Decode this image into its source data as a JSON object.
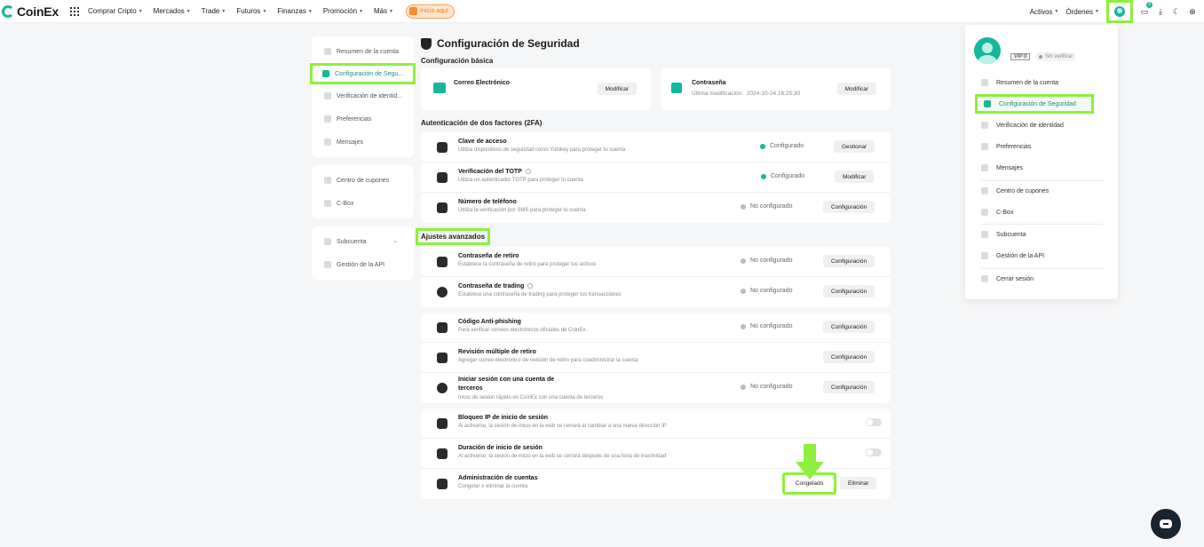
{
  "topbar": {
    "logo": "CoinEx",
    "nav": [
      {
        "label": "Comprar Cripto"
      },
      {
        "label": "Mercados"
      },
      {
        "label": "Trade"
      },
      {
        "label": "Futuros"
      },
      {
        "label": "Finanzas"
      },
      {
        "label": "Promoción"
      },
      {
        "label": "Más"
      }
    ],
    "promo_label": "Inicia aquí",
    "right": {
      "activos": "Activos",
      "ordenes": "Órdenes",
      "notif_count": "9"
    }
  },
  "sidebar": {
    "groups": [
      [
        "Resumen de la cuenta",
        "Configuración de Segu...",
        "Verificación de identid...",
        "Preferencias",
        "Mensajes"
      ],
      [
        "Centro de cupones",
        "C-Box"
      ],
      [
        "Subcuenta",
        "Gestión de la API"
      ]
    ]
  },
  "main": {
    "title": "Configuración de Seguridad",
    "basic": {
      "heading": "Configuración básica",
      "email": {
        "title": "Correo Electrónico",
        "button": "Modificar"
      },
      "password": {
        "title": "Contraseña",
        "sub_label": "Última modificación:",
        "sub_value": "2024-10-24 16:25:30",
        "button": "Modificar"
      }
    },
    "twofa": {
      "heading": "Autenticación de dos factores (2FA)",
      "rows": [
        {
          "title": "Clave de acceso",
          "desc": "Utiliza dispositivos de seguridad como Yubikey para proteger tu cuenta",
          "status": "Configurado",
          "button": "Gestionar"
        },
        {
          "title": "Verificación del TOTP",
          "desc": "Utiliza un autenticador TOTP para proteger tu cuenta",
          "status": "Configurado",
          "button": "Modificar"
        },
        {
          "title": "Número de teléfono",
          "desc": "Utiliza la verificación por SMS para proteger tu cuenta.",
          "status": "No configurado",
          "button": "Configuración"
        }
      ]
    },
    "advanced": {
      "heading": "Ajustes avanzados",
      "block1": [
        {
          "title": "Contraseña de retiro",
          "desc": "Establece la contraseña de retiro para proteger tus activos",
          "status": "No configurado",
          "button": "Configuración"
        },
        {
          "title": "Contraseña de trading",
          "desc": "Establece una contraseña de trading para proteger tus transacciones",
          "status": "No configurado",
          "button": "Configuración"
        }
      ],
      "block2": [
        {
          "title": "Código Anti-phishing",
          "desc": "Para verificar correos electrónicos oficiales de CoinEx.",
          "status": "No configurado",
          "button": "Configuración"
        },
        {
          "title": "Revisión múltiple de retiro",
          "desc": "Agregar correo electrónico de revisión de retiro para coadministrar la cuenta",
          "status": "",
          "button": "Configuración"
        },
        {
          "title_line1": "Iniciar sesión con una cuenta de",
          "title_line2": "terceros",
          "desc": "Inicio de sesión rápido en CoinEx con una cuenta de terceros",
          "status": "No configurado",
          "button": "Configuración"
        }
      ],
      "block3": [
        {
          "title": "Bloqueo IP de inicio de sesión",
          "desc": "Al activarse, la sesión de inicio en la web se cerrará al cambiar a una nueva dirección IP"
        },
        {
          "title": "Duración de inicio de sesión",
          "desc": "Al activarse, la sesión de inicio en la web se cerrará después de una hora de inactividad"
        },
        {
          "title": "Administración de cuentas",
          "desc": "Congelar o eliminar la cuenta",
          "button_freeze": "Congelado",
          "button_delete": "Eliminar"
        }
      ]
    }
  },
  "dropdown": {
    "vip": "VIP 0",
    "verify": "Sin verificar",
    "items": [
      "Resumen de la cuenta",
      "Configuración de Seguridad",
      "Verificación de identidad",
      "Preferencias",
      "Mensajes",
      "Centro de cupones",
      "C-Box",
      "Subcuenta",
      "Gestión de la API",
      "Cerrar sesión"
    ]
  },
  "colors": {
    "brand": "#16b89a",
    "highlight": "#8ef03c",
    "promo": "#ff7a1a"
  }
}
